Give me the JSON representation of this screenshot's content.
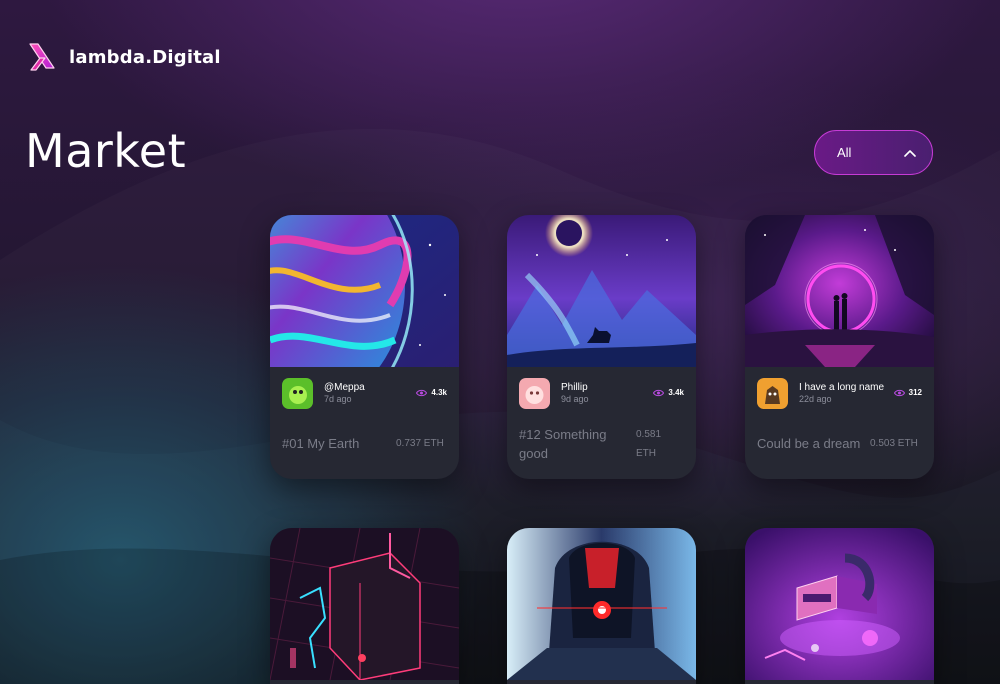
{
  "brand": {
    "name": "lambda.Digital",
    "icon": "lambda-logo-icon"
  },
  "page_title": "Market",
  "filter": {
    "value": "All",
    "icon": "chevron-up-icon"
  },
  "cards": [
    {
      "author": "@Meppa",
      "time": "7d ago",
      "views": "4.3k",
      "title": "#01 My Earth",
      "price": "0.737 ETH",
      "image": "marbled-planet-artwork"
    },
    {
      "author": "Phillip",
      "time": "9d ago",
      "views": "3.4k",
      "title": "#12 Something good",
      "price": "0.581 ETH",
      "image": "moon-deer-landscape-artwork"
    },
    {
      "author": "I have a long name",
      "time": "22d ago",
      "views": "312",
      "title": "Could be a dream",
      "price": "0.503 ETH",
      "image": "neon-portal-couple-artwork"
    },
    {
      "image": "neon-city-cube-artwork"
    },
    {
      "image": "cyber-hooded-figure-artwork"
    },
    {
      "image": "metaverse-vr-headset-artwork"
    }
  ],
  "colors": {
    "accent": "#c63bd6",
    "card_bg": "#262833",
    "muted_text": "#7a7c88"
  }
}
